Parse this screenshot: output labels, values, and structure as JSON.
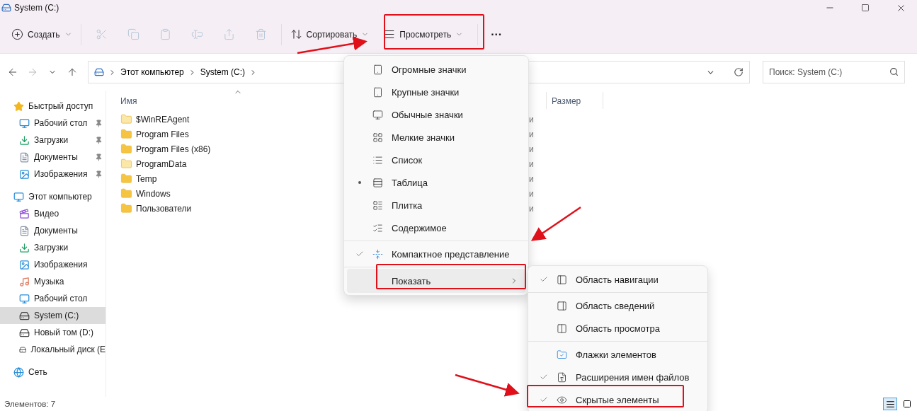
{
  "window": {
    "title": "System (C:)"
  },
  "toolbar": [
    {
      "kind": "menu",
      "label": "Создать",
      "disabled": false
    },
    {
      "kind": "icon",
      "disabled": true
    },
    {
      "kind": "icon",
      "disabled": true
    },
    {
      "kind": "icon",
      "disabled": true
    },
    {
      "kind": "icon",
      "disabled": true
    },
    {
      "kind": "icon",
      "disabled": true
    },
    {
      "kind": "icon",
      "disabled": true
    },
    {
      "kind": "menu",
      "label": "Сортировать",
      "disabled": false
    },
    {
      "kind": "menu",
      "label": "Просмотреть",
      "disabled": false
    },
    {
      "kind": "more",
      "label": "···",
      "disabled": false
    }
  ],
  "address": {
    "crumbs": [
      "Этот компьютер",
      "System (C:)"
    ]
  },
  "search": {
    "placeholder": "Поиск: System (C:)"
  },
  "sidebar": {
    "sections": [
      {
        "label": "Быстрый доступ",
        "selected": false,
        "children": [
          {
            "label": "Рабочий стол",
            "pinned": true,
            "selected": false
          },
          {
            "label": "Загрузки",
            "pinned": true,
            "selected": false
          },
          {
            "label": "Документы",
            "pinned": true,
            "selected": false
          },
          {
            "label": "Изображения",
            "pinned": true,
            "selected": false
          }
        ]
      },
      {
        "label": "Этот компьютер",
        "selected": false,
        "children": [
          {
            "label": "Видео",
            "pinned": false,
            "selected": false
          },
          {
            "label": "Документы",
            "pinned": false,
            "selected": false
          },
          {
            "label": "Загрузки",
            "pinned": false,
            "selected": false
          },
          {
            "label": "Изображения",
            "pinned": false,
            "selected": false
          },
          {
            "label": "Музыка",
            "pinned": false,
            "selected": false
          },
          {
            "label": "Рабочий стол",
            "pinned": false,
            "selected": false
          },
          {
            "label": "System (C:)",
            "pinned": false,
            "selected": true
          },
          {
            "label": "Новый том (D:)",
            "pinned": false,
            "selected": false
          },
          {
            "label": "Локальный диск (E",
            "pinned": false,
            "selected": false
          }
        ]
      },
      {
        "label": "Сеть",
        "selected": false
      }
    ]
  },
  "table": {
    "columns": [
      "Имя",
      "Размер"
    ],
    "rows": [
      {
        "name": "$WinREAgent",
        "column_2": "и",
        "light": true
      },
      {
        "name": "Program Files",
        "column_2": "и",
        "light": false
      },
      {
        "name": "Program Files (x86)",
        "column_2": "и",
        "light": false
      },
      {
        "name": "ProgramData",
        "column_2": "и",
        "light": true
      },
      {
        "name": "Temp",
        "column_2": "и",
        "light": false
      },
      {
        "name": "Windows",
        "column_2": "и",
        "light": false
      },
      {
        "name": "Пользователи",
        "column_2": "и",
        "light": false
      }
    ]
  },
  "view_menu": {
    "sections": [
      {
        "items": [
          {
            "label": "Огромные значки",
            "selected": false
          },
          {
            "label": "Крупные значки",
            "selected": false
          },
          {
            "label": "Обычные значки",
            "selected": false
          },
          {
            "label": "Мелкие значки",
            "selected": false
          },
          {
            "label": "Список",
            "selected": false
          },
          {
            "label": "Таблица",
            "selected": true
          },
          {
            "label": "Плитка",
            "selected": false
          },
          {
            "label": "Содержимое",
            "selected": false
          }
        ]
      },
      {
        "items": [
          {
            "label": "Компактное представление",
            "selected": true
          }
        ]
      },
      {
        "items": [
          {
            "label": "Показать",
            "submenu": true,
            "hovered": true
          }
        ]
      }
    ]
  },
  "show_menu": {
    "sections": [
      {
        "items": [
          {
            "label": "Область навигации",
            "checked": true
          }
        ]
      },
      {
        "items": [
          {
            "label": "Область сведений",
            "checked": false
          },
          {
            "label": "Область просмотра",
            "checked": false
          }
        ]
      },
      {
        "items": [
          {
            "label": "Флажки элементов",
            "checked": false
          },
          {
            "label": "Расширения имен файлов",
            "checked": true
          },
          {
            "label": "Скрытые элементы",
            "checked": true
          }
        ]
      }
    ]
  },
  "status_bar": {
    "text": "Элементов: 7",
    "views": [
      {
        "selected": true
      },
      {
        "selected": false
      }
    ]
  }
}
